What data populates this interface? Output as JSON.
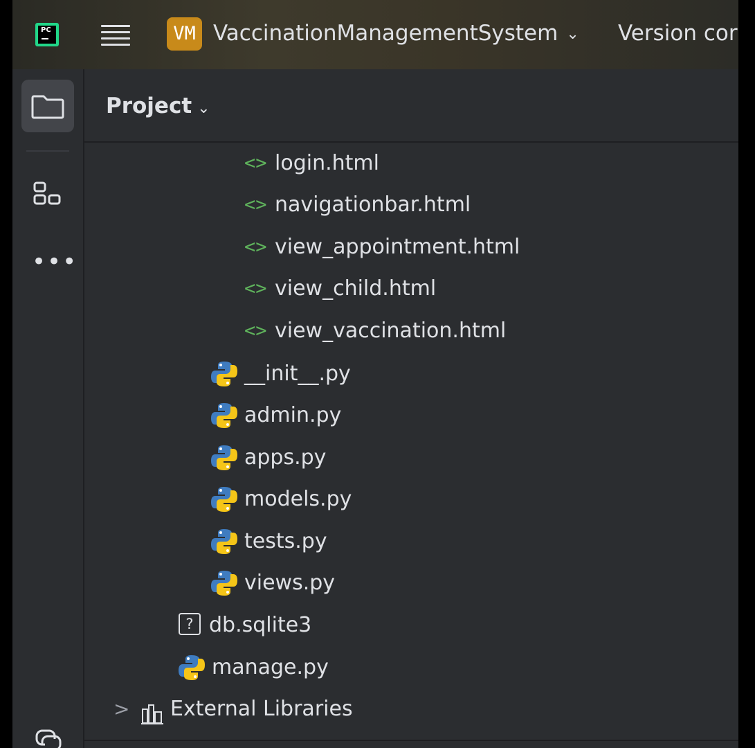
{
  "titlebar": {
    "logo_text": "PC",
    "project_badge": "VM",
    "project_name": "VaccinationManagementSystem",
    "version_control": "Version cor"
  },
  "toolstrip": {
    "items": [
      {
        "name": "project-tool",
        "icon": "folder-icon",
        "active": true
      },
      {
        "name": "structure-tool",
        "icon": "structure-icon",
        "active": false
      },
      {
        "name": "more-tools",
        "icon": "more-icon",
        "active": false
      },
      {
        "name": "python-console-tool",
        "icon": "python-console-icon",
        "active": false
      }
    ],
    "more_label": "•••"
  },
  "panel": {
    "title": "Project",
    "tree": [
      {
        "label": "login.html",
        "type": "html"
      },
      {
        "label": "navigationbar.html",
        "type": "html"
      },
      {
        "label": "view_appointment.html",
        "type": "html"
      },
      {
        "label": "view_child.html",
        "type": "html"
      },
      {
        "label": "view_vaccination.html",
        "type": "html"
      },
      {
        "label": "__init__.py",
        "type": "python"
      },
      {
        "label": "admin.py",
        "type": "python"
      },
      {
        "label": "apps.py",
        "type": "python"
      },
      {
        "label": "models.py",
        "type": "python"
      },
      {
        "label": "tests.py",
        "type": "python"
      },
      {
        "label": "views.py",
        "type": "python"
      },
      {
        "label": "db.sqlite3",
        "type": "unknown"
      },
      {
        "label": "manage.py",
        "type": "python"
      },
      {
        "label": "External Libraries",
        "type": "library"
      }
    ],
    "html_icon_glyph": "<>",
    "unknown_icon_glyph": "?",
    "expand_glyph": ">"
  },
  "colors": {
    "background": "#2b2d30",
    "html_icon": "#5fb35c",
    "python_blue": "#3f7cc0",
    "python_yellow": "#f5c518",
    "badge": "#c88a1a"
  }
}
